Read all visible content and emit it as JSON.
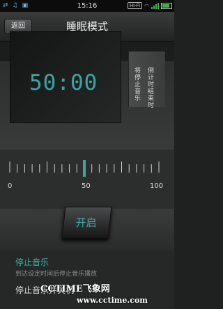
{
  "status_bar": {
    "time": "15:16",
    "left_icons": [
      "usb-icon",
      "music-icon",
      "image-icon"
    ],
    "wifi_label": "Hi-Fi",
    "signal_bars": 4,
    "battery_level": 0.8
  },
  "header": {
    "back_label": "返回",
    "title": "睡眠模式"
  },
  "timer": {
    "display": "50:00",
    "side_text_1": "倒计时结束时",
    "side_text_2": "将停止音乐",
    "accent_color": "#3aa6a3"
  },
  "slider": {
    "labels": [
      "0",
      "50",
      "100"
    ],
    "min": 0,
    "max": 100,
    "value": 50
  },
  "start_button": {
    "label": "开启"
  },
  "options": [
    {
      "title": "停止音乐",
      "description": "到达设定时间后停止音乐播放",
      "selected": true
    },
    {
      "title": "停止音乐并关机",
      "description": "",
      "selected": false
    }
  ],
  "watermark": {
    "line1": "CCTIME飞象网",
    "line2": "www.cctime.com"
  }
}
